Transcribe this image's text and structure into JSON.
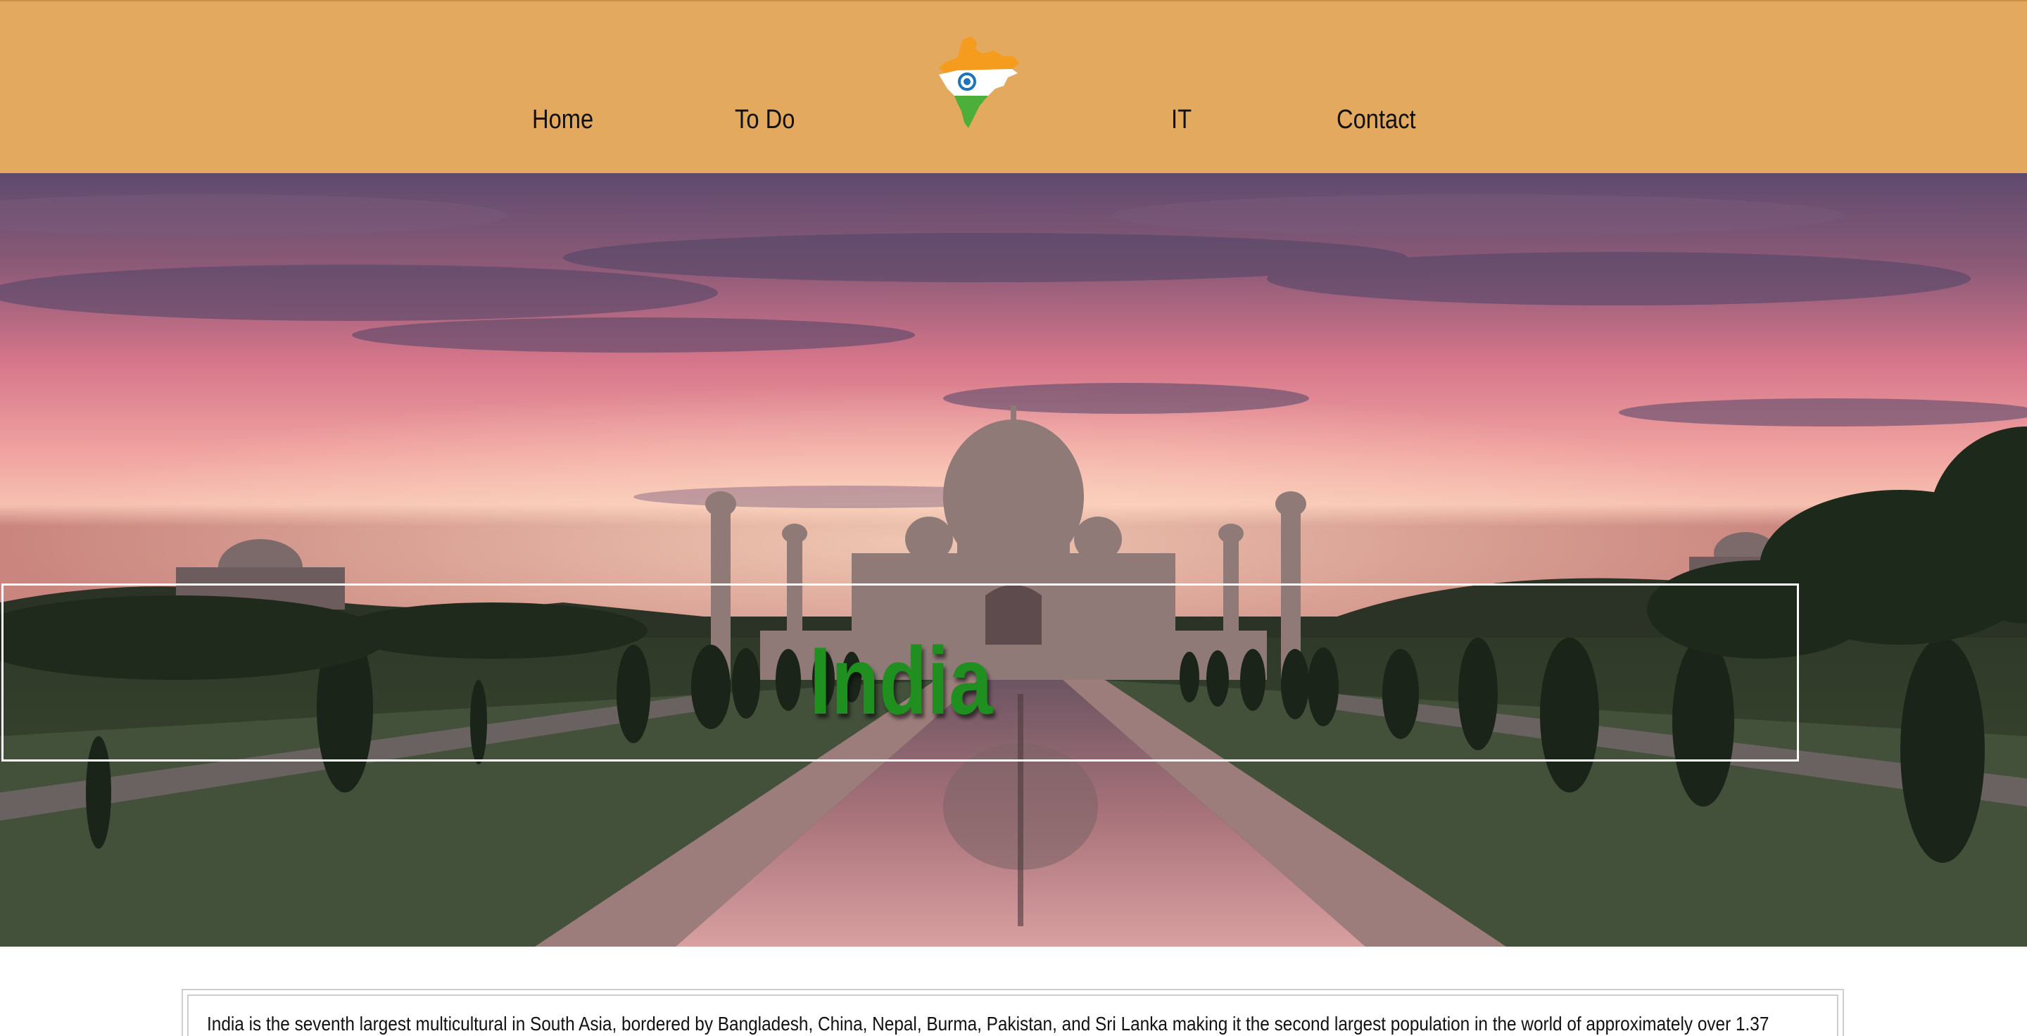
{
  "nav": {
    "items": [
      {
        "label": "Home"
      },
      {
        "label": "To Do"
      },
      {
        "label": "IT"
      },
      {
        "label": "Contact"
      }
    ]
  },
  "logo": {
    "icon": "india-map-flag-icon"
  },
  "hero": {
    "title": "India",
    "title_color": "#1f8f1f",
    "image": "taj-mahal-sunset-image"
  },
  "content": {
    "paragraph": "India is the seventh largest multicultural in South Asia, bordered by Bangladesh, China, Nepal, Burma, Pakistan, and Sri Lanka making it the second largest population in the world of approximately over 1.37"
  },
  "colors": {
    "header_bg": "#e3a95e",
    "saffron": "#f59b1e",
    "green": "#4caf3a",
    "chakra": "#1e73be"
  }
}
